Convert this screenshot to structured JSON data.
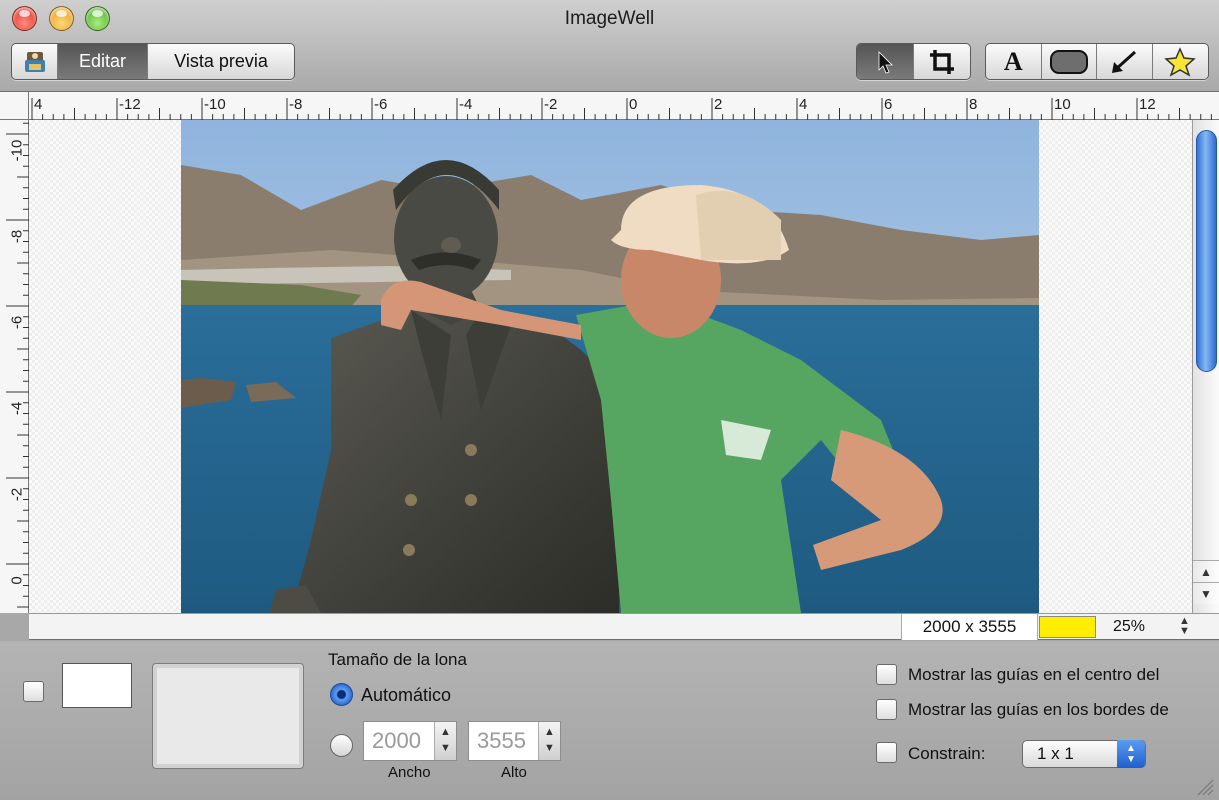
{
  "window": {
    "title": "ImageWell"
  },
  "toolbar": {
    "mode_tabs": [
      "Editar",
      "Vista previa"
    ],
    "active_tab": "Editar",
    "text_tool_glyph": "A",
    "tools": [
      "pointer-icon",
      "crop-icon",
      "text-tool-icon",
      "rounded-rect-icon",
      "arrow-draw-icon",
      "star-icon"
    ]
  },
  "rulers": {
    "horizontal": [
      "4",
      "-12",
      "-10",
      "-8",
      "-6",
      "-4",
      "-2",
      "0",
      "2",
      "4",
      "6",
      "8",
      "10",
      "12"
    ],
    "vertical": [
      "-10",
      "-8",
      "-6",
      "-4",
      "-2",
      "0"
    ]
  },
  "status": {
    "image_size": "2000 x 3555",
    "swatch_color": "#ffee00",
    "zoom": "25%"
  },
  "panel": {
    "canvas_size_title": "Tamaño de la lona",
    "auto_label": "Automático",
    "width_value": "2000",
    "height_value": "3555",
    "width_caption": "Ancho",
    "height_caption": "Alto",
    "guide_center_label": "Mostrar las guías en el centro del",
    "guide_edges_label": "Mostrar las guías en los bordes de",
    "constrain_label": "Constrain:",
    "constrain_value": "1 x 1"
  }
}
